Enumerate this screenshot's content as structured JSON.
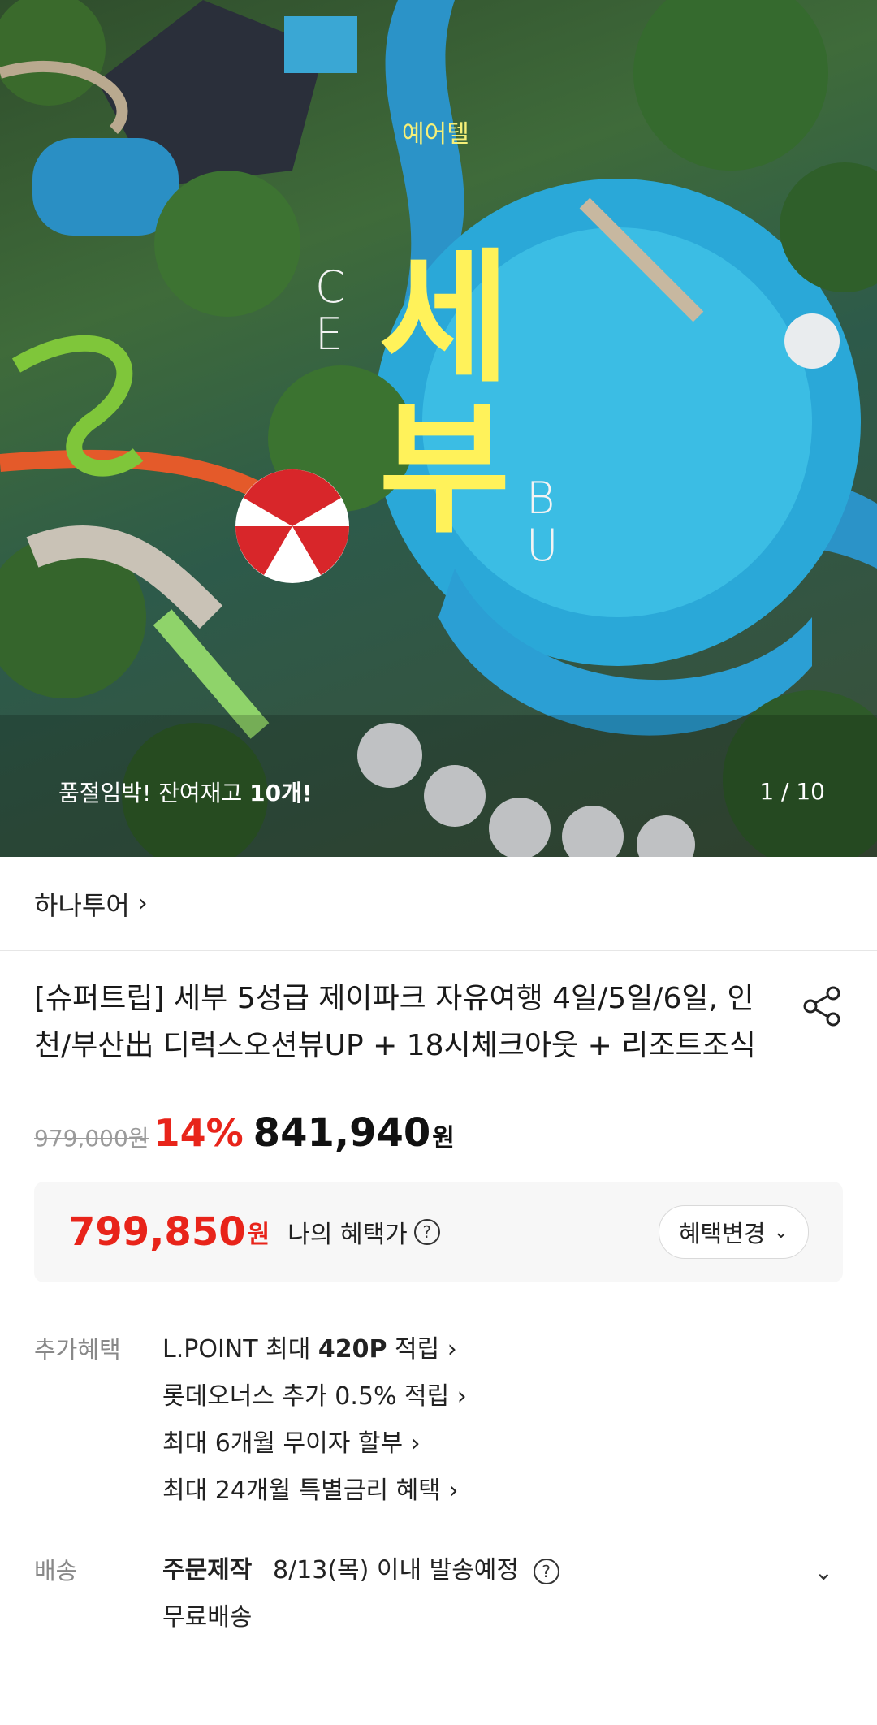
{
  "hero": {
    "brand": "예어텔",
    "title_line1": "세",
    "title_line2": "부",
    "latin_left": "C\nE",
    "latin_right": "B\nU",
    "stock_prefix": "품절임박! 잔여재고 ",
    "stock_count": "10개!",
    "counter": "1 / 10"
  },
  "seller": {
    "name": "하나투어",
    "chevron": "›"
  },
  "product": {
    "title": "[슈퍼트립] 세부 5성급 제이파크 자유여행 4일/5일/6일, 인천/부산出 디럭스오션뷰UP + 18시체크아웃 + 리조트조식",
    "share_icon": "share-icon"
  },
  "price": {
    "original": "979,000원",
    "discount": "14%",
    "sale": "841,940",
    "unit": "원"
  },
  "benefit": {
    "price": "799,850",
    "unit": "원",
    "label": "나의 혜택가",
    "help": "?",
    "change_label": "혜택변경",
    "dropdown": "⌄"
  },
  "extra_benefits": {
    "label": "추가혜택",
    "items": [
      {
        "pre": "L.POINT 최대 ",
        "bold": "420P",
        "post": " 적립 ›"
      },
      {
        "pre": "롯데오너스 추가 0.5% 적립 ›",
        "bold": "",
        "post": ""
      },
      {
        "pre": "최대 6개월 무이자 할부 ›",
        "bold": "",
        "post": ""
      },
      {
        "pre": "최대 24개월 특별금리 혜택 ›",
        "bold": "",
        "post": ""
      }
    ]
  },
  "shipping": {
    "label": "배송",
    "type": "주문제작",
    "date": "8/13(목) 이내 발송예정",
    "help": "?",
    "fee": "무료배송",
    "expand": "⌄"
  },
  "colors": {
    "accent_red": "#e8241a",
    "title_yellow": "#fff25a"
  }
}
